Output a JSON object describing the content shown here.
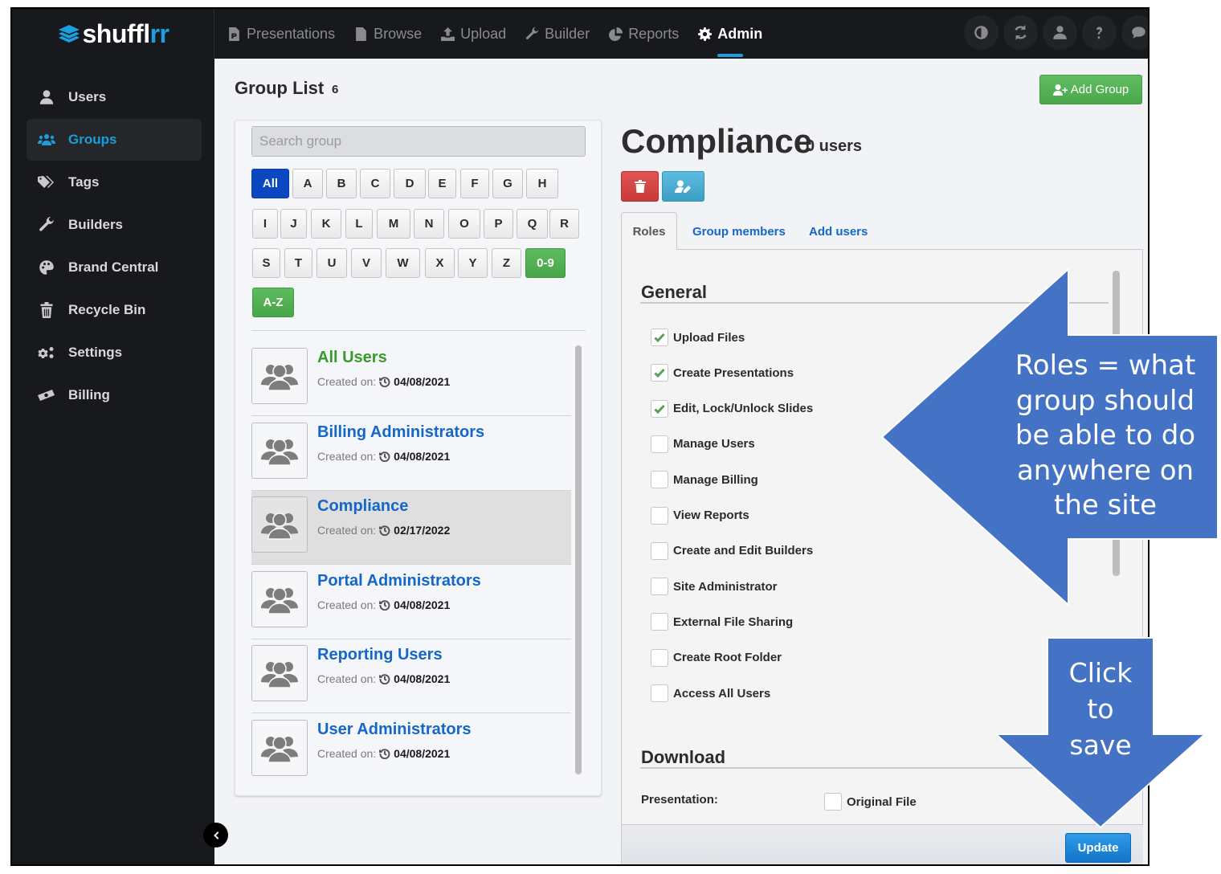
{
  "app": {
    "logo_text_main": "shuffl",
    "logo_text_accent": "rr"
  },
  "topnav": {
    "items": [
      {
        "label": "Presentations",
        "icon": "presentation-file-icon"
      },
      {
        "label": "Browse",
        "icon": "document-icon"
      },
      {
        "label": "Upload",
        "icon": "upload-icon"
      },
      {
        "label": "Builder",
        "icon": "wrench-icon"
      },
      {
        "label": "Reports",
        "icon": "pie-chart-icon"
      },
      {
        "label": "Admin",
        "icon": "gear-icon",
        "active": true
      }
    ],
    "right_icons": [
      "contrast-icon",
      "refresh-icon",
      "user-icon",
      "help-icon",
      "chat-icon"
    ]
  },
  "sidebar": {
    "items": [
      {
        "label": "Users",
        "icon": "user-icon"
      },
      {
        "label": "Groups",
        "icon": "users-icon",
        "active": true
      },
      {
        "label": "Tags",
        "icon": "tags-icon"
      },
      {
        "label": "Builders",
        "icon": "wrench-icon"
      },
      {
        "label": "Brand Central",
        "icon": "palette-icon"
      },
      {
        "label": "Recycle Bin",
        "icon": "trash-icon"
      },
      {
        "label": "Settings",
        "icon": "gears-icon"
      },
      {
        "label": "Billing",
        "icon": "money-icon"
      }
    ]
  },
  "group_list": {
    "title": "Group List",
    "count": "6",
    "add_button": "Add Group",
    "search_placeholder": "Search group",
    "filters": {
      "row1": [
        "All",
        "A",
        "B",
        "C",
        "D",
        "E",
        "F",
        "G",
        "H"
      ],
      "row2": [
        "I",
        "J",
        "K",
        "L",
        "M",
        "N",
        "O",
        "P",
        "Q",
        "R"
      ],
      "row3": [
        "S",
        "T",
        "U",
        "V",
        "W",
        "X",
        "Y",
        "Z",
        "0-9"
      ],
      "row4": [
        "A-Z"
      ],
      "active": "All"
    },
    "created_label": "Created on:",
    "groups": [
      {
        "name": "All Users",
        "created": "04/08/2021",
        "highlight": "green"
      },
      {
        "name": "Billing Administrators",
        "created": "04/08/2021"
      },
      {
        "name": "Compliance",
        "created": "02/17/2022",
        "selected": true
      },
      {
        "name": "Portal Administrators",
        "created": "04/08/2021"
      },
      {
        "name": "Reporting Users",
        "created": "04/08/2021"
      },
      {
        "name": "User Administrators",
        "created": "04/08/2021"
      }
    ]
  },
  "detail": {
    "title": "Compliance",
    "user_count": "0 users",
    "tabs": [
      "Roles",
      "Group members",
      "Add users"
    ],
    "active_tab": "Roles",
    "general": {
      "title": "General",
      "permissions": [
        {
          "label": "Upload Files",
          "checked": true
        },
        {
          "label": "Create Presentations",
          "checked": true
        },
        {
          "label": "Edit, Lock/Unlock Slides",
          "checked": true
        },
        {
          "label": "Manage Users",
          "checked": false
        },
        {
          "label": "Manage Billing",
          "checked": false
        },
        {
          "label": "View Reports",
          "checked": false
        },
        {
          "label": "Create and Edit Builders",
          "checked": false
        },
        {
          "label": "Site Administrator",
          "checked": false
        },
        {
          "label": "External File Sharing",
          "checked": false
        },
        {
          "label": "Create Root Folder",
          "checked": false
        },
        {
          "label": "Access All Users",
          "checked": false
        }
      ]
    },
    "download": {
      "title": "Download",
      "presentation_label": "Presentation:",
      "original_file_label": "Original File",
      "original_file_checked": false
    },
    "update_button": "Update"
  },
  "annotations": {
    "roles_callout": [
      "Roles = what",
      "group should",
      "be able to do",
      "anywhere on",
      "the site"
    ],
    "save_callout": [
      "Click",
      "to",
      "save"
    ],
    "color": "#4472c4"
  }
}
